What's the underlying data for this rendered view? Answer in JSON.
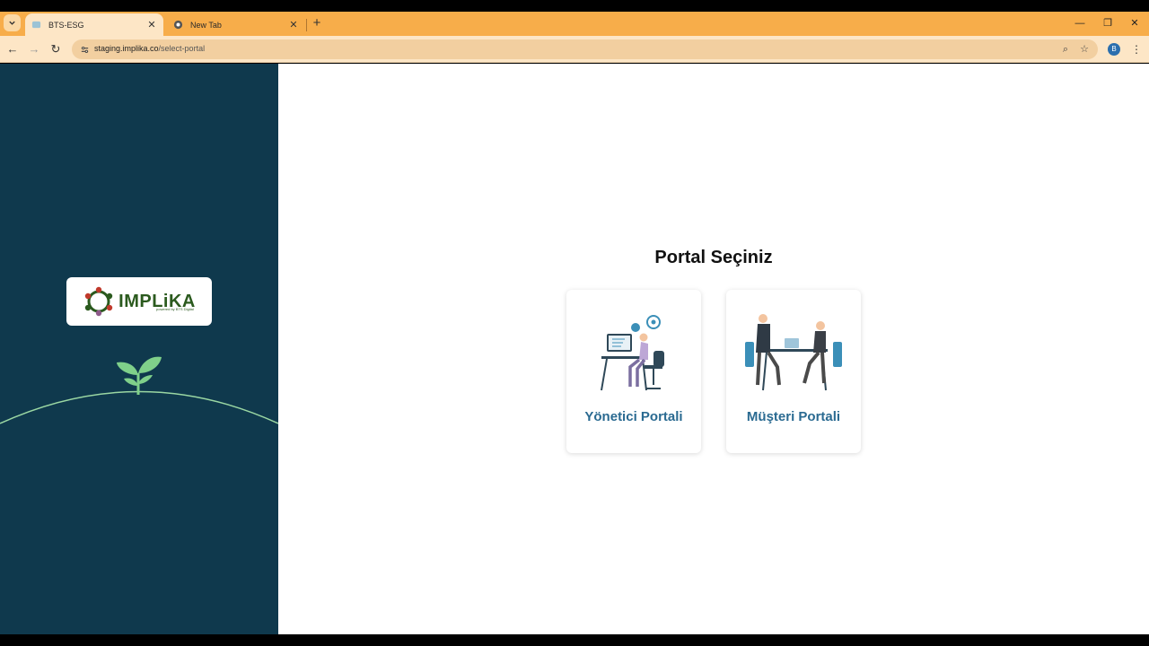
{
  "browser": {
    "tabs": [
      {
        "label": "BTS-ESG",
        "active": true
      },
      {
        "label": "New Tab",
        "active": false
      }
    ],
    "url_host": "staging.implika.co",
    "url_path": "/select-portal",
    "profile_initial": "B",
    "accent_color": "#f7ad4a"
  },
  "sidebar": {
    "logo_text": "IMPLiKA",
    "logo_subtext": "powered by BTS Digital",
    "background_color": "#0f394d"
  },
  "main": {
    "heading": "Portal Seçiniz",
    "cards": [
      {
        "label": "Yönetici Portali",
        "icon": "admin-desk-illustration"
      },
      {
        "label": "Müşteri Portali",
        "icon": "customer-meeting-illustration"
      }
    ]
  }
}
